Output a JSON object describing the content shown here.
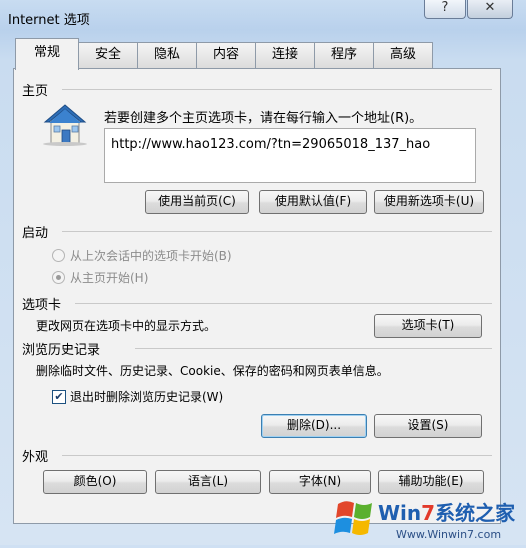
{
  "window": {
    "title": "Internet 选项",
    "help_label": "?",
    "close_label": "✕"
  },
  "tabs": [
    "常规",
    "安全",
    "隐私",
    "内容",
    "连接",
    "程序",
    "高级"
  ],
  "homepage": {
    "heading": "主页",
    "instruction": "若要创建多个主页选项卡，请在每行输入一个地址(R)。",
    "url_value": "http://www.hao123.com/?tn=29065018_137_hao",
    "use_current_label": "使用当前页(C)",
    "use_default_label": "使用默认值(F)",
    "use_new_tab_label": "使用新选项卡(U)"
  },
  "startup": {
    "heading": "启动",
    "option_last_session": "从上次会话中的选项卡开始(B)",
    "option_home": "从主页开始(H)"
  },
  "tabs_section": {
    "heading": "选项卡",
    "description": "更改网页在选项卡中的显示方式。",
    "tabs_button_label": "选项卡(T)"
  },
  "history": {
    "heading": "浏览历史记录",
    "description": "删除临时文件、历史记录、Cookie、保存的密码和网页表单信息。",
    "checkbox_label": "退出时删除浏览历史记录(W)",
    "checkbox_checked": true,
    "delete_label": "删除(D)...",
    "settings_label": "设置(S)"
  },
  "appearance": {
    "heading": "外观",
    "colors_label": "颜色(O)",
    "languages_label": "语言(L)",
    "fonts_label": "字体(N)",
    "accessibility_label": "辅助功能(E)"
  },
  "watermark": {
    "brand": "Win7系统之家",
    "site": "Www.Winwin7.com"
  }
}
